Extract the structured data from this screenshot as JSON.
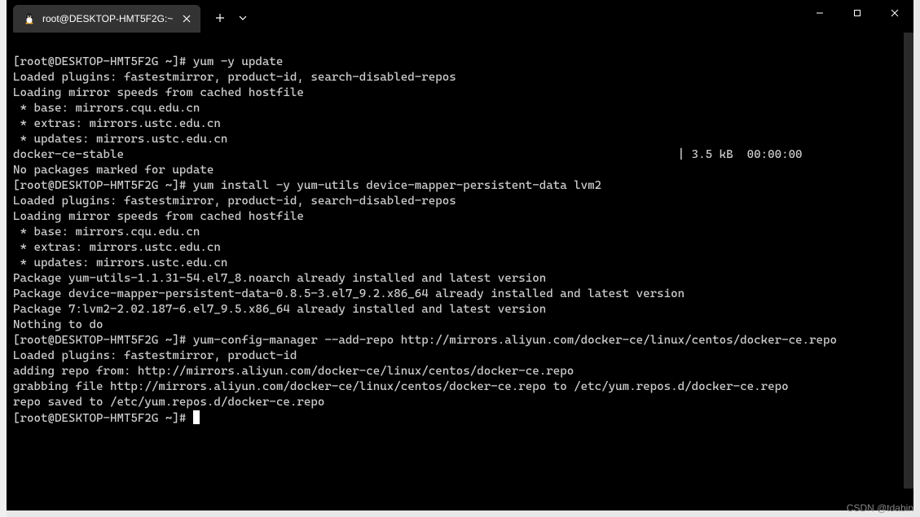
{
  "titlebar": {
    "tab_title": "root@DESKTOP-HMT5F2G:~",
    "tab_close": "×",
    "new_tab": "+",
    "dropdown": "⌄"
  },
  "window_controls": {
    "minimize": "—",
    "maximize": "□",
    "close": "×"
  },
  "terminal": {
    "lines": [
      "[root@DESKTOP-HMT5F2G ~]# yum -y update",
      "Loaded plugins: fastestmirror, product-id, search-disabled-repos",
      "Loading mirror speeds from cached hostfile",
      " * base: mirrors.cqu.edu.cn",
      " * extras: mirrors.ustc.edu.cn",
      " * updates: mirrors.ustc.edu.cn",
      "docker-ce-stable                                                                                | 3.5 kB  00:00:00",
      "No packages marked for update",
      "[root@DESKTOP-HMT5F2G ~]# yum install -y yum-utils device-mapper-persistent-data lvm2",
      "Loaded plugins: fastestmirror, product-id, search-disabled-repos",
      "Loading mirror speeds from cached hostfile",
      " * base: mirrors.cqu.edu.cn",
      " * extras: mirrors.ustc.edu.cn",
      " * updates: mirrors.ustc.edu.cn",
      "Package yum-utils-1.1.31-54.el7_8.noarch already installed and latest version",
      "Package device-mapper-persistent-data-0.8.5-3.el7_9.2.x86_64 already installed and latest version",
      "Package 7:lvm2-2.02.187-6.el7_9.5.x86_64 already installed and latest version",
      "Nothing to do",
      "[root@DESKTOP-HMT5F2G ~]# yum-config-manager --add-repo http://mirrors.aliyun.com/docker-ce/linux/centos/docker-ce.repo",
      "Loaded plugins: fastestmirror, product-id",
      "adding repo from: http://mirrors.aliyun.com/docker-ce/linux/centos/docker-ce.repo",
      "grabbing file http://mirrors.aliyun.com/docker-ce/linux/centos/docker-ce.repo to /etc/yum.repos.d/docker-ce.repo",
      "repo saved to /etc/yum.repos.d/docker-ce.repo"
    ],
    "prompt": "[root@DESKTOP-HMT5F2G ~]# "
  },
  "watermark": "CSDN @tdabin"
}
